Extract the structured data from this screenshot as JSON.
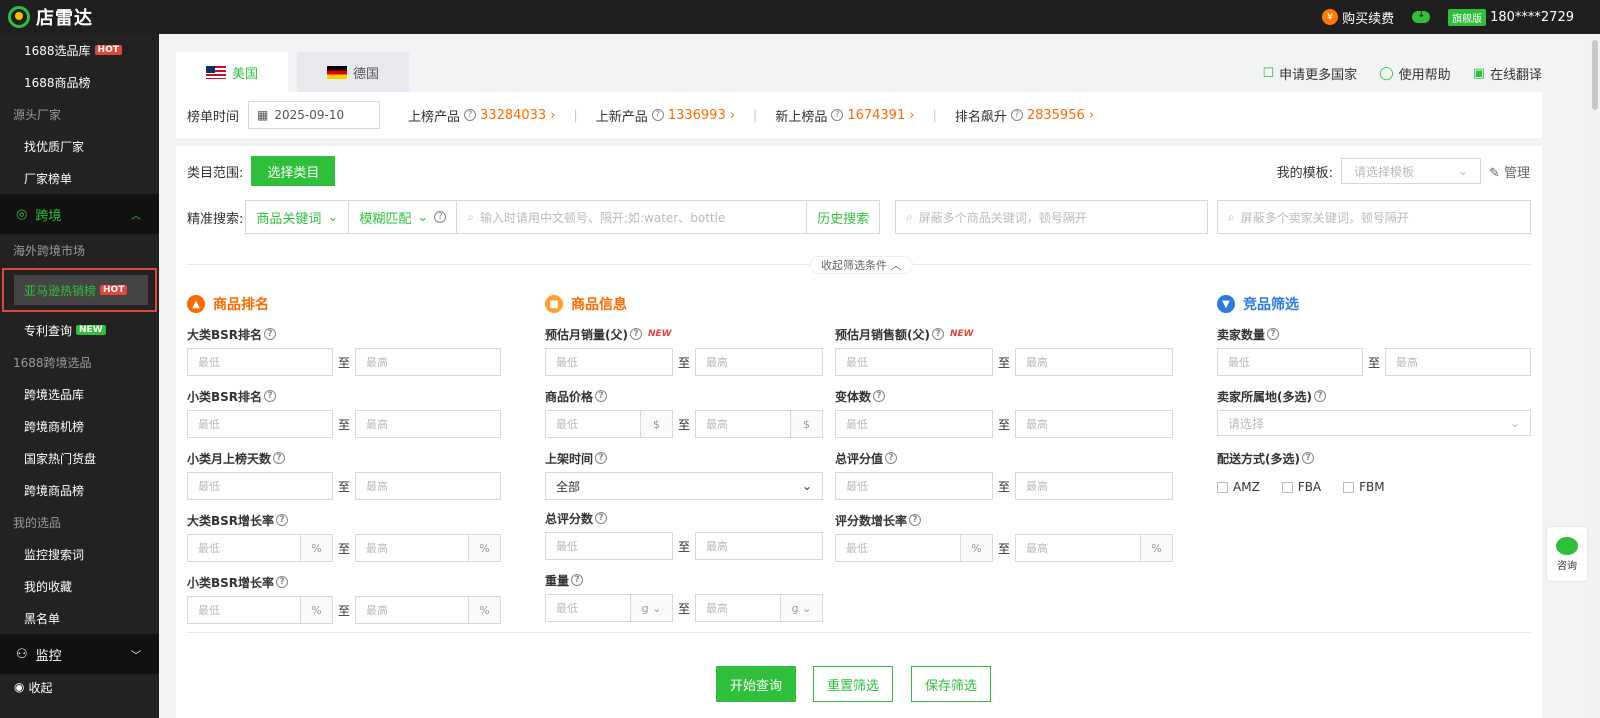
{
  "app": {
    "name": "店雷达"
  },
  "topbar": {
    "buy_label": "购买续费",
    "edition": "旗舰版",
    "phone": "180****2729"
  },
  "sidebar": {
    "items_top": [
      {
        "label": "1688选品库",
        "tag": "HOT"
      },
      {
        "label": "1688商品榜"
      }
    ],
    "group_source": "源头厂家",
    "source_items": [
      {
        "label": "找优质厂家"
      },
      {
        "label": "厂家榜单"
      }
    ],
    "cat_cross": "跨境",
    "group_overseas": "海外跨境市场",
    "active_item": {
      "label": "亚马逊热销榜",
      "tag": "HOT"
    },
    "patent_item": {
      "label": "专利查询",
      "tag": "NEW"
    },
    "group_1688cross": "1688跨境选品",
    "cross_items": [
      {
        "label": "跨境选品库"
      },
      {
        "label": "跨境商机榜"
      },
      {
        "label": "国家热门货盘"
      },
      {
        "label": "跨境商品榜"
      }
    ],
    "group_mine": "我的选品",
    "mine_items": [
      {
        "label": "监控搜索词"
      },
      {
        "label": "我的收藏"
      },
      {
        "label": "黑名单"
      }
    ],
    "cat_monitor": "监控",
    "collapse": "收起"
  },
  "tabs": [
    {
      "label": "美国"
    },
    {
      "label": "德国"
    }
  ],
  "tab_links": [
    {
      "label": "申请更多国家"
    },
    {
      "label": "使用帮助"
    },
    {
      "label": "在线翻译"
    }
  ],
  "stats": {
    "date_label": "榜单时间",
    "date_value": "2025-09-10",
    "items": [
      {
        "label": "上榜产品",
        "value": "33284033"
      },
      {
        "label": "上新产品",
        "value": "1336993"
      },
      {
        "label": "新上榜品",
        "value": "1674391"
      },
      {
        "label": "排名飙升",
        "value": "2835956"
      }
    ]
  },
  "filters": {
    "cat_label": "类目范围:",
    "cat_button": "选择类目",
    "tpl_label": "我的模板:",
    "tpl_placeholder": "请选择模板",
    "manage": "管理",
    "search_label": "精准搜索:",
    "search_type": "商品关键词",
    "match_type": "模糊匹配",
    "search_placeholder": "输入时请用中文顿号、隔开;如:water、bottle",
    "history": "历史搜索",
    "block_product_placeholder": "屏蔽多个商品关键词，顿号隔开",
    "block_seller_placeholder": "屏蔽多个卖家关键词，顿号隔开",
    "collapse_label": "收起筛选条件"
  },
  "sections": {
    "rank": "商品排名",
    "info": "商品信息",
    "compete": "竞品筛选"
  },
  "fields": {
    "min": "最低",
    "max": "最高",
    "to": "至",
    "pct": "%",
    "usd": "$",
    "g": "g",
    "big_bsr": "大类BSR排名",
    "small_bsr": "小类BSR排名",
    "small_days": "小类月上榜天数",
    "big_growth": "大类BSR增长率",
    "small_growth": "小类BSR增长率",
    "monthly_sales": "预估月销量(父)",
    "monthly_revenue": "预估月销售额(父)",
    "new_tag": "NEW",
    "price": "商品价格",
    "variants": "变体数",
    "listing_time": "上架时间",
    "listing_value": "全部",
    "total_rating": "总评分值",
    "rating_count": "总评分数",
    "rating_growth": "评分数增长率",
    "weight": "重量",
    "seller_count": "卖家数量",
    "seller_region": "卖家所属地(多选)",
    "region_placeholder": "请选择",
    "delivery": "配送方式(多选)",
    "delivery_opts": [
      "AMZ",
      "FBA",
      "FBM"
    ]
  },
  "actions": {
    "search": "开始查询",
    "reset": "重置筛选",
    "save": "保存筛选"
  },
  "consult": "咨询"
}
